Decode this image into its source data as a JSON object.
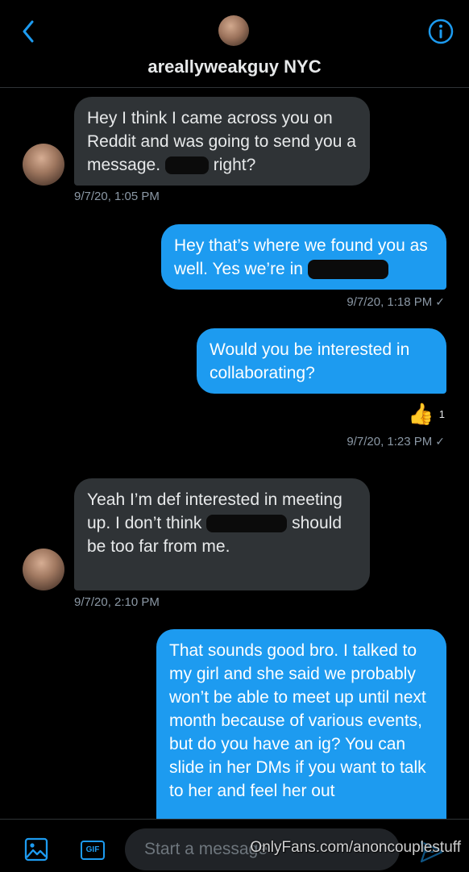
{
  "header": {
    "title": "areallyweakguy NYC"
  },
  "messages": [
    {
      "direction": "in",
      "text_parts": [
        "Hey I think I came across you on Reddit and was going to send you a message.",
        "right?"
      ],
      "timestamp": "9/7/20, 1:05 PM"
    },
    {
      "direction": "out",
      "text_parts": [
        "Hey that’s where we found you as well. Yes we’re in"
      ],
      "timestamp": "9/7/20, 1:18 PM"
    },
    {
      "direction": "out",
      "text": "Would you be interested in collaborating?",
      "reaction": {
        "emoji": "👍",
        "count": "1"
      },
      "timestamp": "9/7/20, 1:23 PM"
    },
    {
      "direction": "in",
      "text_parts": [
        "Yeah I’m def interested in meeting up. I don’t think",
        "should be too far from me."
      ],
      "timestamp": "9/7/20, 2:10 PM"
    },
    {
      "direction": "out",
      "text": "That sounds good bro. I talked to my girl and she said we probably won’t be able to meet up until next month because of various events, but do you have an ig? You can slide in her DMs if you want to talk to her and feel her out"
    }
  ],
  "composer": {
    "placeholder": "Start a message",
    "gif_label": "GIF"
  },
  "watermark": "OnlyFans.com/anoncouplestuff",
  "colors": {
    "accent": "#1d9bf0",
    "incoming_bubble": "#2f3336",
    "background": "#000000"
  },
  "icons": [
    "back-chevron-icon",
    "info-icon",
    "image-icon",
    "gif-icon",
    "send-icon"
  ]
}
